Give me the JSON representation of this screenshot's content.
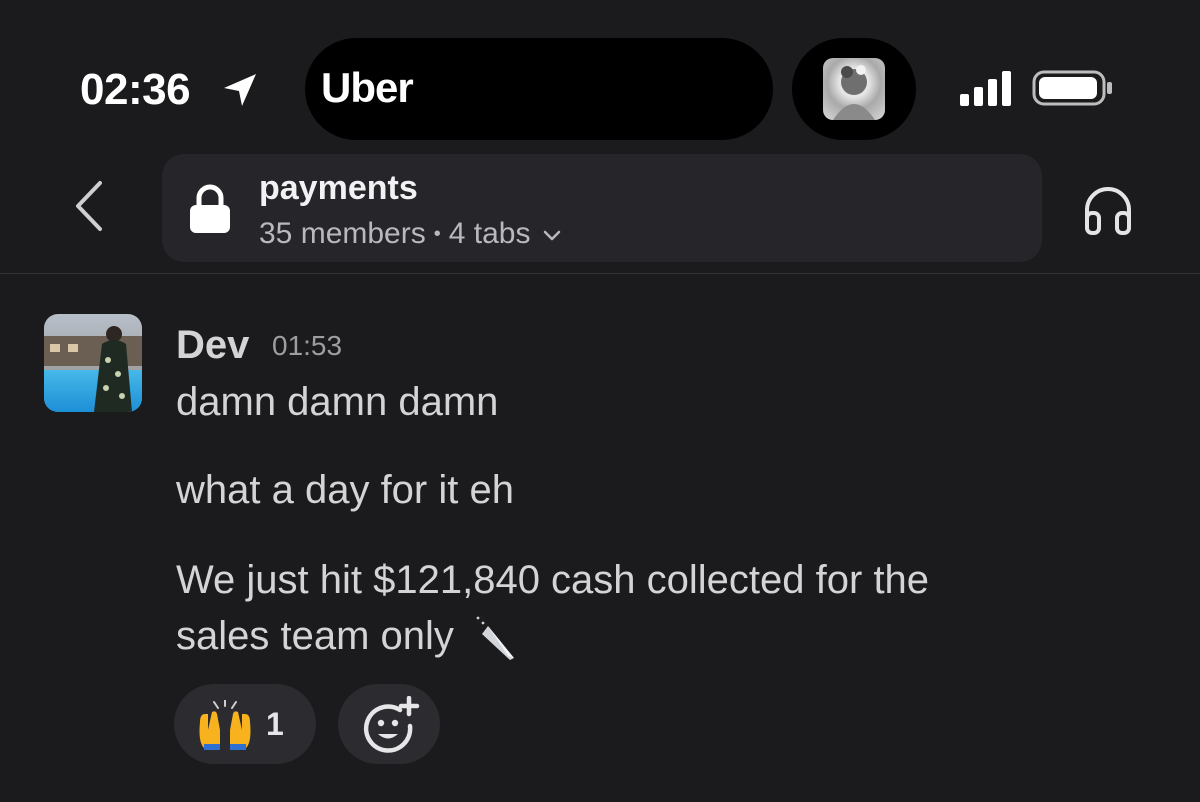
{
  "status_bar": {
    "time": "02:36",
    "location_icon": "location-arrow-icon",
    "live_activity_app": "Uber",
    "signal_icon": "cellular-signal-icon",
    "battery_icon": "battery-icon"
  },
  "header": {
    "back_icon": "chevron-left-icon",
    "channel_icon": "lock-icon",
    "channel_name": "payments",
    "members": "35 members",
    "separator": "•",
    "tabs": "4 tabs",
    "dropdown_icon": "chevron-down-icon",
    "huddle_icon": "headphones-icon"
  },
  "message": {
    "author": "Dev",
    "time": "01:53",
    "lines": [
      "damn damn damn",
      "what a day for it eh",
      "We just hit $121,840 cash collected for the",
      "sales team only"
    ],
    "trailing_emoji_icon": "knife-icon"
  },
  "reactions": [
    {
      "emoji_icon": "raised-hands-icon",
      "count": "1"
    }
  ],
  "add_reaction_icon": "add-emoji-icon",
  "colors": {
    "background": "#1b1b1d",
    "header_box": "#26262a",
    "reaction_pill": "#2c2c30",
    "text_primary": "#d4d4d6",
    "text_secondary": "#9d9da2"
  }
}
